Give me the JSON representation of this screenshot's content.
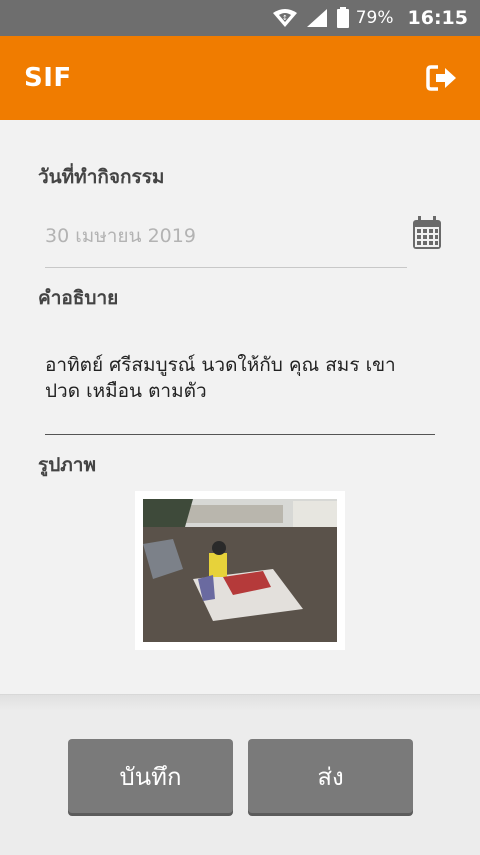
{
  "status_bar": {
    "battery": "79%",
    "time": "16:15"
  },
  "app_bar": {
    "title": "SIF",
    "logout_icon": "logout-icon"
  },
  "form": {
    "date_label": "วันที่ทำกิจกรรม",
    "date_value": "30 เมษายน 2019",
    "description_label": "คำอธิบาย",
    "description_value": "อาทิตย์ ศรีสมบูรณ์ นวดให้กับ คุณ สมร เขา ปวด เหมือน ตามตัว",
    "photo_label": "รูปภาพ"
  },
  "buttons": {
    "save": "บันทึก",
    "send": "ส่ง"
  },
  "colors": {
    "accent": "#f07c00",
    "status_bar": "#6e6e6e",
    "button": "#7a7a7a"
  }
}
